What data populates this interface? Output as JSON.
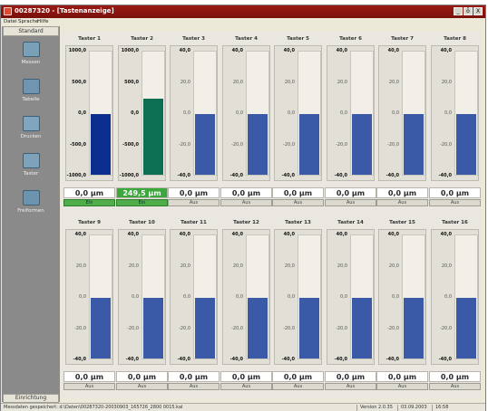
{
  "window": {
    "title": "00287320 - [Tastenanzeige]",
    "buttons": [
      "_",
      "ȱ",
      "X"
    ]
  },
  "menu": [
    "Datei",
    "Sprache",
    "Hilfe"
  ],
  "sidebar": {
    "header": "Standard",
    "items": [
      {
        "label": "Messen",
        "icon": "measure-icon",
        "color": "#7aa0b8"
      },
      {
        "label": "Tabelle",
        "icon": "table-icon",
        "color": "#6f95b0"
      },
      {
        "label": "Drucken",
        "icon": "print-icon",
        "color": "#7fa6be"
      },
      {
        "label": "Taster",
        "icon": "probe-icon",
        "color": "#7ea2ba"
      },
      {
        "label": "Freiformen",
        "icon": "freeform-icon",
        "color": "#6d94ae"
      }
    ],
    "footer": "Einrichtung"
  },
  "probes": [
    {
      "name": "Taster 1",
      "ticks": [
        "1000,0",
        "500,0",
        "0,0",
        "-500,0",
        "-1000,0"
      ],
      "value": "0,0 µm",
      "value_num": 0,
      "range": 1000,
      "bar_color": "#0a2f8f",
      "readout_active": false,
      "toggle": "Ein",
      "toggle_on": true
    },
    {
      "name": "Taster 2",
      "ticks": [
        "1000,0",
        "500,0",
        "0,0",
        "-500,0",
        "-1000,0"
      ],
      "value": "249,5 µm",
      "value_num": 249.5,
      "range": 1000,
      "bar_color": "#0d6f52",
      "readout_active": true,
      "toggle": "Ein",
      "toggle_on": true
    },
    {
      "name": "Taster 3",
      "ticks": [
        "40,0",
        "20,0",
        "0,0",
        "-20,0",
        "-40,0"
      ],
      "value": "0,0 µm",
      "value_num": 0,
      "range": 40,
      "bar_color": "#3a5aa8",
      "readout_active": false,
      "toggle": "Aus",
      "toggle_on": false
    },
    {
      "name": "Taster 4",
      "ticks": [
        "40,0",
        "20,0",
        "0,0",
        "-20,0",
        "-40,0"
      ],
      "value": "0,0 µm",
      "value_num": 0,
      "range": 40,
      "bar_color": "#3a5aa8",
      "readout_active": false,
      "toggle": "Aus",
      "toggle_on": false
    },
    {
      "name": "Taster 5",
      "ticks": [
        "40,0",
        "20,0",
        "0,0",
        "-20,0",
        "-40,0"
      ],
      "value": "0,0 µm",
      "value_num": 0,
      "range": 40,
      "bar_color": "#3a5aa8",
      "readout_active": false,
      "toggle": "Aus",
      "toggle_on": false
    },
    {
      "name": "Taster 6",
      "ticks": [
        "40,0",
        "20,0",
        "0,0",
        "-20,0",
        "-40,0"
      ],
      "value": "0,0 µm",
      "value_num": 0,
      "range": 40,
      "bar_color": "#3a5aa8",
      "readout_active": false,
      "toggle": "Aus",
      "toggle_on": false
    },
    {
      "name": "Taster 7",
      "ticks": [
        "40,0",
        "20,0",
        "0,0",
        "-20,0",
        "-40,0"
      ],
      "value": "0,0 µm",
      "value_num": 0,
      "range": 40,
      "bar_color": "#3a5aa8",
      "readout_active": false,
      "toggle": "Aus",
      "toggle_on": false
    },
    {
      "name": "Taster 8",
      "ticks": [
        "40,0",
        "20,0",
        "0,0",
        "-20,0",
        "-40,0"
      ],
      "value": "0,0 µm",
      "value_num": 0,
      "range": 40,
      "bar_color": "#3a5aa8",
      "readout_active": false,
      "toggle": "Aus",
      "toggle_on": false
    },
    {
      "name": "Taster 9",
      "ticks": [
        "40,0",
        "20,0",
        "0,0",
        "-20,0",
        "-40,0"
      ],
      "value": "0,0 µm",
      "value_num": 0,
      "range": 40,
      "bar_color": "#3a5aa8",
      "readout_active": false,
      "toggle": "Aus",
      "toggle_on": false
    },
    {
      "name": "Taster 10",
      "ticks": [
        "40,0",
        "20,0",
        "0,0",
        "-20,0",
        "-40,0"
      ],
      "value": "0,0 µm",
      "value_num": 0,
      "range": 40,
      "bar_color": "#3a5aa8",
      "readout_active": false,
      "toggle": "Aus",
      "toggle_on": false
    },
    {
      "name": "Taster 11",
      "ticks": [
        "40,0",
        "20,0",
        "0,0",
        "-20,0",
        "-40,0"
      ],
      "value": "0,0 µm",
      "value_num": 0,
      "range": 40,
      "bar_color": "#3a5aa8",
      "readout_active": false,
      "toggle": "Aus",
      "toggle_on": false
    },
    {
      "name": "Taster 12",
      "ticks": [
        "40,0",
        "20,0",
        "0,0",
        "-20,0",
        "-40,0"
      ],
      "value": "0,0 µm",
      "value_num": 0,
      "range": 40,
      "bar_color": "#3a5aa8",
      "readout_active": false,
      "toggle": "Aus",
      "toggle_on": false
    },
    {
      "name": "Taster 13",
      "ticks": [
        "40,0",
        "20,0",
        "0,0",
        "-20,0",
        "-40,0"
      ],
      "value": "0,0 µm",
      "value_num": 0,
      "range": 40,
      "bar_color": "#3a5aa8",
      "readout_active": false,
      "toggle": "Aus",
      "toggle_on": false
    },
    {
      "name": "Taster 14",
      "ticks": [
        "40,0",
        "20,0",
        "0,0",
        "-20,0",
        "-40,0"
      ],
      "value": "0,0 µm",
      "value_num": 0,
      "range": 40,
      "bar_color": "#3a5aa8",
      "readout_active": false,
      "toggle": "Aus",
      "toggle_on": false
    },
    {
      "name": "Taster 15",
      "ticks": [
        "40,0",
        "20,0",
        "0,0",
        "-20,0",
        "-40,0"
      ],
      "value": "0,0 µm",
      "value_num": 0,
      "range": 40,
      "bar_color": "#3a5aa8",
      "readout_active": false,
      "toggle": "Aus",
      "toggle_on": false
    },
    {
      "name": "Taster 16",
      "ticks": [
        "40,0",
        "20,0",
        "0,0",
        "-20,0",
        "-40,0"
      ],
      "value": "0,0 µm",
      "value_num": 0,
      "range": 40,
      "bar_color": "#3a5aa8",
      "readout_active": false,
      "toggle": "Aus",
      "toggle_on": false
    }
  ],
  "status": {
    "message": "Messdaten gespeichert: d:\\Daten\\00287320-20030903_165726_2800 0015.kal",
    "version": "Version 2.0.35",
    "date": "03.09.2003",
    "time": "16:58"
  }
}
